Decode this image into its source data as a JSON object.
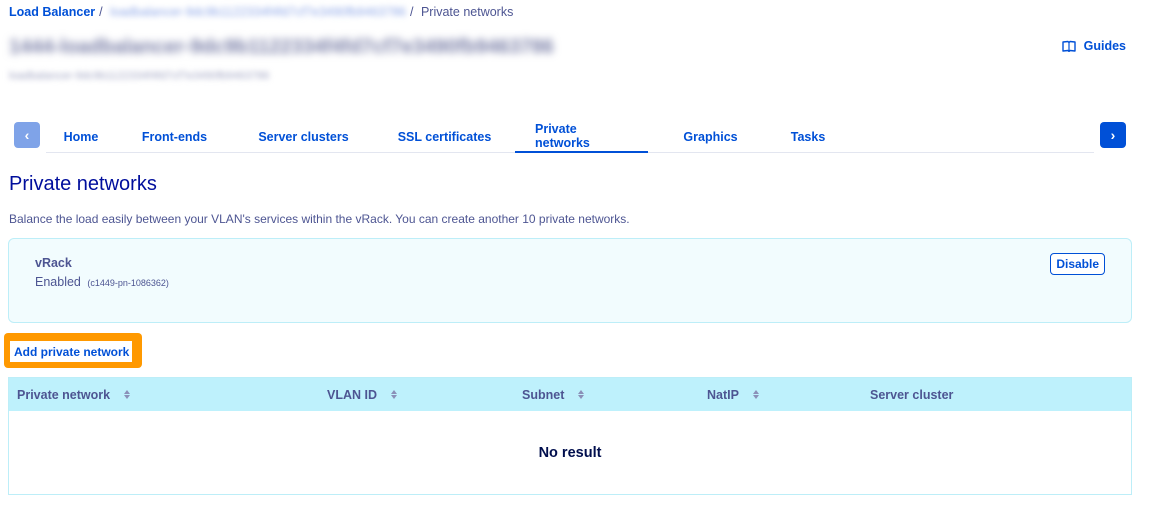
{
  "breadcrumb": {
    "root": "Load Balancer",
    "service": "loadbalancer-9dc9b1122334f4fd7cf7e3490fb9463786",
    "current": "Private networks"
  },
  "header": {
    "title": "1444-loadbalancer-9dc9b1122334f4fd7cf7e3490fb9463786",
    "subtitle": "loadbalancer-9dc9b1122334f4fd7cf7e3490fb9463786",
    "guides_label": "Guides"
  },
  "tabs": {
    "prev_icon": "chevron-left-icon",
    "next_icon": "chevron-right-icon",
    "items": [
      {
        "label": "Home"
      },
      {
        "label": "Front-ends"
      },
      {
        "label": "Server clusters"
      },
      {
        "label": "SSL certificates"
      },
      {
        "label": "Private networks"
      },
      {
        "label": "Graphics"
      },
      {
        "label": "Tasks"
      }
    ],
    "active": "Private networks"
  },
  "main": {
    "title": "Private networks",
    "description": "Balance the load easily between your VLAN's services within the vRack. You can create another 10 private networks.",
    "vrack": {
      "name": "vRack",
      "status": "Enabled",
      "id": "(c1449-pn-1086362)",
      "disable_label": "Disable"
    },
    "add_button_label": "Add private network",
    "table": {
      "columns": [
        {
          "label": "Private network",
          "sortable": true
        },
        {
          "label": "VLAN ID",
          "sortable": true
        },
        {
          "label": "Subnet",
          "sortable": true
        },
        {
          "label": "NatIP",
          "sortable": true
        },
        {
          "label": "Server cluster",
          "sortable": false
        }
      ],
      "empty_text": "No result"
    }
  },
  "colors": {
    "link": "#0050d7",
    "text": "#4d5592",
    "title": "#000e9c",
    "highlight": "#ff9900",
    "table_header": "#bef1fc",
    "panel_bg": "#f2fcfe"
  }
}
